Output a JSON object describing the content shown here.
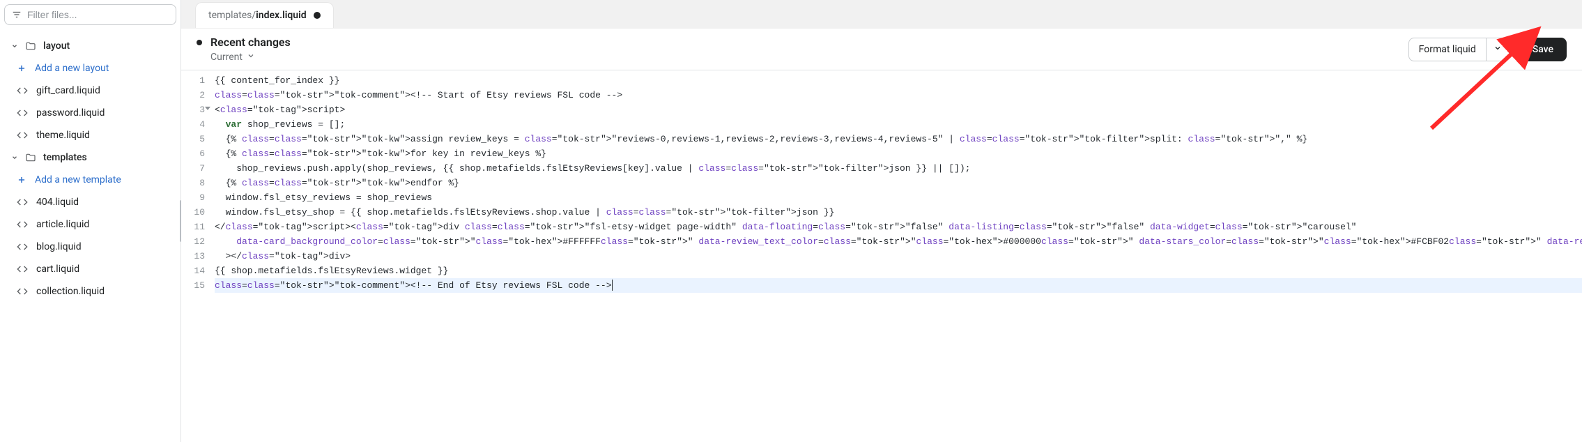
{
  "sidebar": {
    "filter_placeholder": "Filter files...",
    "groups": [
      {
        "name": "layout",
        "add_label": "Add a new layout",
        "files": [
          "gift_card.liquid",
          "password.liquid",
          "theme.liquid"
        ]
      },
      {
        "name": "templates",
        "add_label": "Add a new template",
        "files": [
          "404.liquid",
          "article.liquid",
          "blog.liquid",
          "cart.liquid",
          "collection.liquid"
        ]
      }
    ]
  },
  "tab": {
    "path_prefix": "templates/",
    "filename": "index.liquid",
    "dirty": true
  },
  "titlebar": {
    "title": "Recent changes",
    "version_label": "Current",
    "format_button": "Format liquid",
    "save_button": "Save"
  },
  "editor": {
    "lines": [
      {
        "n": 1,
        "raw": "{{ content_for_index }}"
      },
      {
        "n": 2,
        "raw": "<!-- Start of Etsy reviews FSL code -->"
      },
      {
        "n": 3,
        "raw": "<script>",
        "fold": true
      },
      {
        "n": 4,
        "raw": "  var shop_reviews = [];"
      },
      {
        "n": 5,
        "raw": "  {% assign review_keys = \"reviews-0,reviews-1,reviews-2,reviews-3,reviews-4,reviews-5\" | split: \",\" %}"
      },
      {
        "n": 6,
        "raw": "  {% for key in review_keys %}"
      },
      {
        "n": 7,
        "raw": "    shop_reviews.push.apply(shop_reviews, {{ shop.metafields.fslEtsyReviews[key].value | json }} || []);"
      },
      {
        "n": 8,
        "raw": "  {% endfor %}"
      },
      {
        "n": 9,
        "raw": "  window.fsl_etsy_reviews = shop_reviews"
      },
      {
        "n": 10,
        "raw": "  window.fsl_etsy_shop = {{ shop.metafields.fslEtsyReviews.shop.value | json }}"
      },
      {
        "n": 11,
        "raw": "</script><div class=\"fsl-etsy-widget page-width\" data-floating=\"false\" data-listing=\"false\" data-widget=\"carousel\""
      },
      {
        "n": 12,
        "raw": "    data-card_background_color=\"#FFFFFF\" data-review_text_color=\"#000000\" data-stars_color=\"#FCBF02\" data-reviewer_text_color=\"#000000\" data-verified_badge_color=\"#57A7D4\" data-navigati"
      },
      {
        "n": 13,
        "raw": "  ></div>"
      },
      {
        "n": 14,
        "raw": "{{ shop.metafields.fslEtsyReviews.widget }}"
      },
      {
        "n": 15,
        "raw": "<!-- End of Etsy reviews FSL code -->",
        "active": true
      }
    ]
  },
  "colors": {
    "accent_link": "#2c6ecb",
    "save_bg": "#202223"
  }
}
